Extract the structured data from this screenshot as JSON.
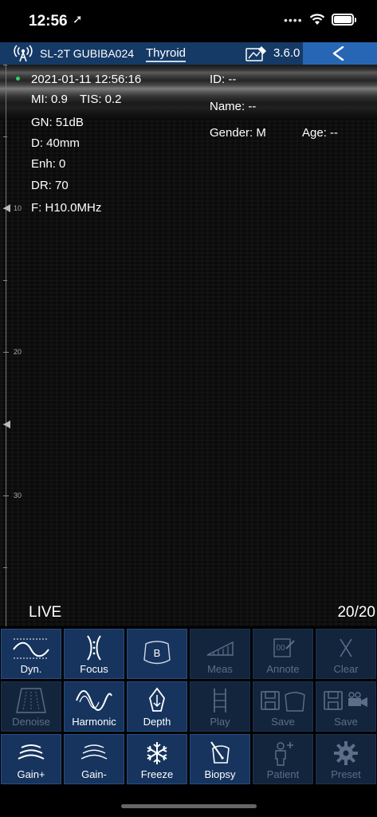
{
  "status_bar": {
    "time": "12:56",
    "location_glyph": "➚",
    "signal_dots": "••••"
  },
  "top_bar": {
    "probe": "SL-2T GUBIBA024",
    "preset": "Thyroid",
    "version": "3.6.0"
  },
  "image": {
    "datetime": "2021-01-11 12:56:16",
    "mi": "MI: 0.9",
    "tis": "TIS: 0.2",
    "gain": "GN: 51dB",
    "depth": "D: 40mm",
    "enh": "Enh: 0",
    "dr": "DR: 70",
    "freq": "F: H10.0MHz",
    "patient_id": "ID: --",
    "patient_name": "Name: --",
    "gender": "Gender: M",
    "age": "Age: --",
    "scale_labels": [
      "10",
      "20",
      "30"
    ],
    "mode": "LIVE",
    "frame_counter": "20/20"
  },
  "controls": {
    "dyn": "Dyn.",
    "focus": "Focus",
    "meas": "Meas",
    "annote": "Annote",
    "clear": "Clear",
    "denoise": "Denoise",
    "harmonic": "Harmonic",
    "depth": "Depth",
    "play": "Play",
    "save_image": "Save",
    "save_video": "Save",
    "gain_plus": "Gain+",
    "gain_minus": "Gain-",
    "freeze": "Freeze",
    "biopsy": "Biopsy",
    "patient": "Patient",
    "preset": "Preset"
  }
}
